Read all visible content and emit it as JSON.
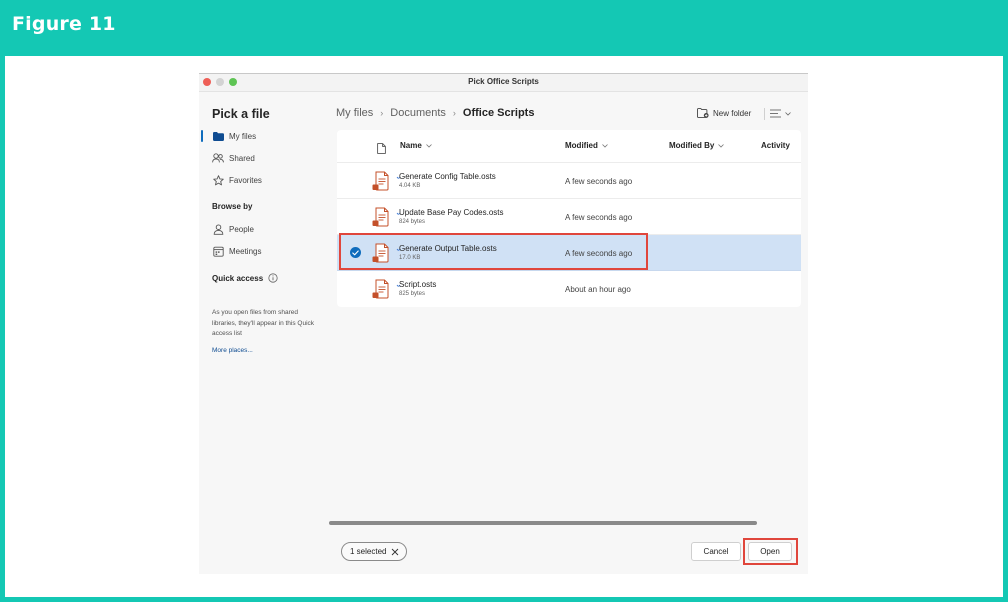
{
  "figure": {
    "title": "Figure 11"
  },
  "dialog": {
    "title": "Pick Office Scripts"
  },
  "sidebar": {
    "heading": "Pick a file",
    "items": [
      {
        "label": "My files",
        "icon": "folder-icon"
      },
      {
        "label": "Shared",
        "icon": "people-icon"
      },
      {
        "label": "Favorites",
        "icon": "star-icon"
      }
    ],
    "browse_heading": "Browse by",
    "browse_items": [
      {
        "label": "People",
        "icon": "person-icon"
      },
      {
        "label": "Meetings",
        "icon": "calendar-icon"
      }
    ],
    "quick_access_heading": "Quick access",
    "quick_access_note": "As you open files from shared libraries, they'll appear in this Quick access list",
    "more_places": "More places..."
  },
  "breadcrumb": {
    "items": [
      "My files",
      "Documents",
      "Office Scripts"
    ]
  },
  "toolbar": {
    "new_folder": "New folder"
  },
  "columns": {
    "name": "Name",
    "modified": "Modified",
    "modified_by": "Modified By",
    "activity": "Activity"
  },
  "files": [
    {
      "name": "Generate Config Table.osts",
      "size": "4.04 KB",
      "modified": "A few seconds ago",
      "selected": false
    },
    {
      "name": "Update Base Pay Codes.osts",
      "size": "824 bytes",
      "modified": "A few seconds ago",
      "selected": false
    },
    {
      "name": "Generate Output Table.osts",
      "size": "17.0 KB",
      "modified": "A few seconds ago",
      "selected": true
    },
    {
      "name": "Script.osts",
      "size": "825 bytes",
      "modified": "About an hour ago",
      "selected": false
    }
  ],
  "footer": {
    "selected_chip": "1 selected",
    "cancel": "Cancel",
    "open": "Open"
  },
  "colors": {
    "accent": "#0f6cbd",
    "highlight": "#e0463c",
    "figure_bg": "#14c8b4",
    "selected_row": "#d0e1f5"
  }
}
